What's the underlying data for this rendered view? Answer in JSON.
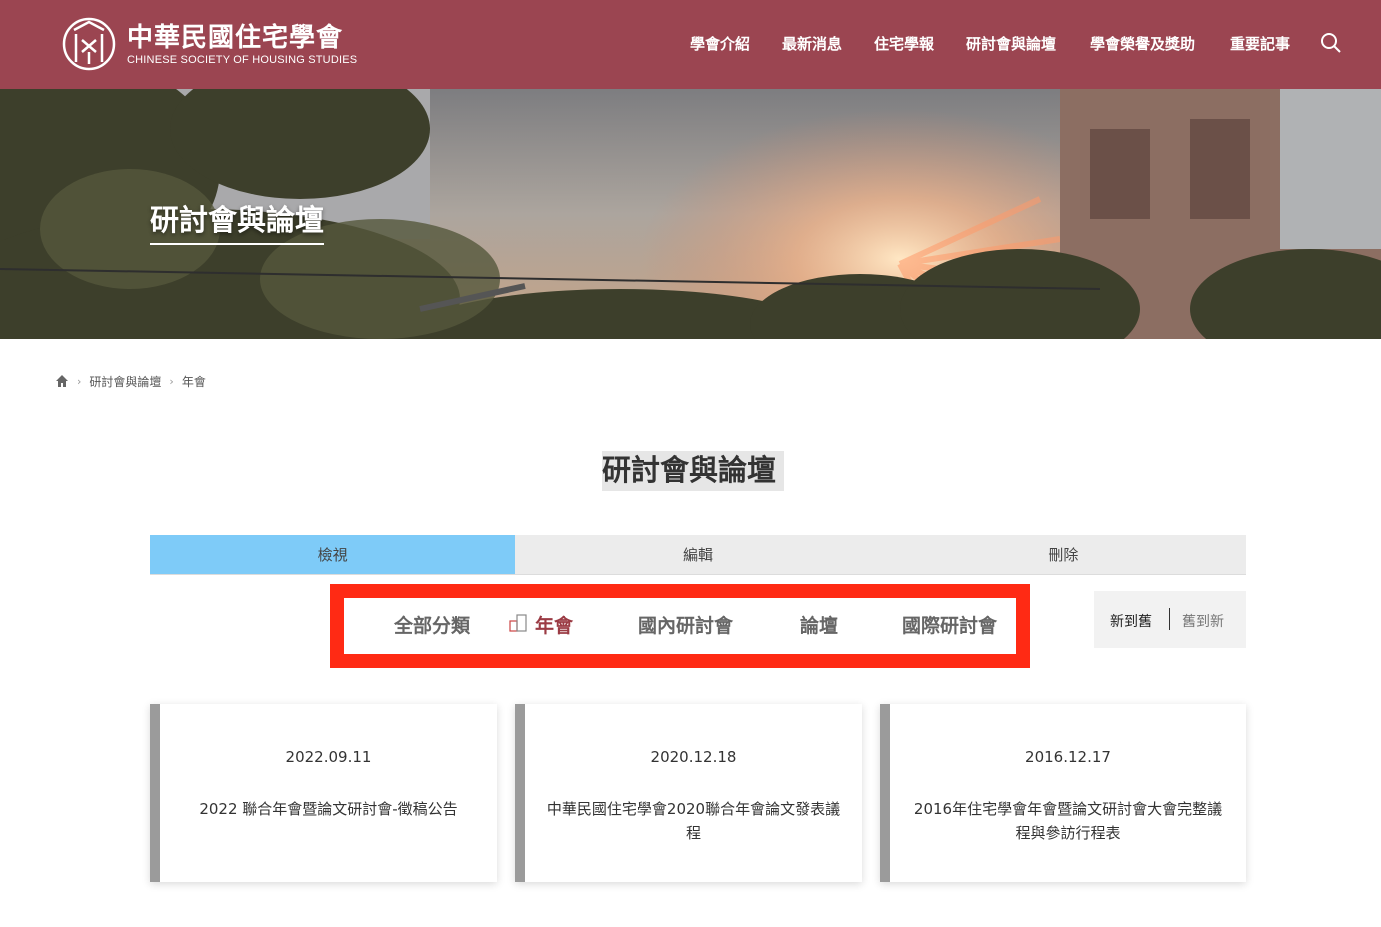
{
  "header": {
    "logo_cn": "中華民國住宅學會",
    "logo_en": "CHINESE SOCIETY OF HOUSING STUDIES",
    "nav": [
      "學會介紹",
      "最新消息",
      "住宅學報",
      "研討會與論壇",
      "學會榮譽及獎助",
      "重要記事"
    ],
    "search_icon": "search-icon",
    "bg_color": "#9b4551"
  },
  "banner": {
    "title": "研討會與論壇"
  },
  "breadcrumb": {
    "home_icon": "home-icon",
    "items": [
      "研討會與論壇",
      "年會"
    ]
  },
  "page_title": "研討會與論壇",
  "tabs": [
    {
      "label": "檢視",
      "active": true
    },
    {
      "label": "編輯",
      "active": false
    },
    {
      "label": "刪除",
      "active": false
    }
  ],
  "categories": {
    "items": [
      "全部分類",
      "年會",
      "國內研討會",
      "論壇",
      "國際研討會"
    ],
    "selected": "年會",
    "selected_icon": "building-icon"
  },
  "sort": {
    "newest": "新到舊",
    "oldest": "舊到新",
    "selected": "新到舊"
  },
  "cards": [
    {
      "date": "2022.09.11",
      "title": "2022 聯合年會暨論文研討會-徵稿公告"
    },
    {
      "date": "2020.12.18",
      "title": "中華民國住宅學會2020聯合年會論文發表議程"
    },
    {
      "date": "2016.12.17",
      "title": "2016年住宅學會年會暨論文研討會大會完整議程與參訪行程表"
    }
  ],
  "colors": {
    "accent": "#9b3b44",
    "tab_active": "#7ecbf8",
    "highlight_border": "#ff2a14"
  }
}
